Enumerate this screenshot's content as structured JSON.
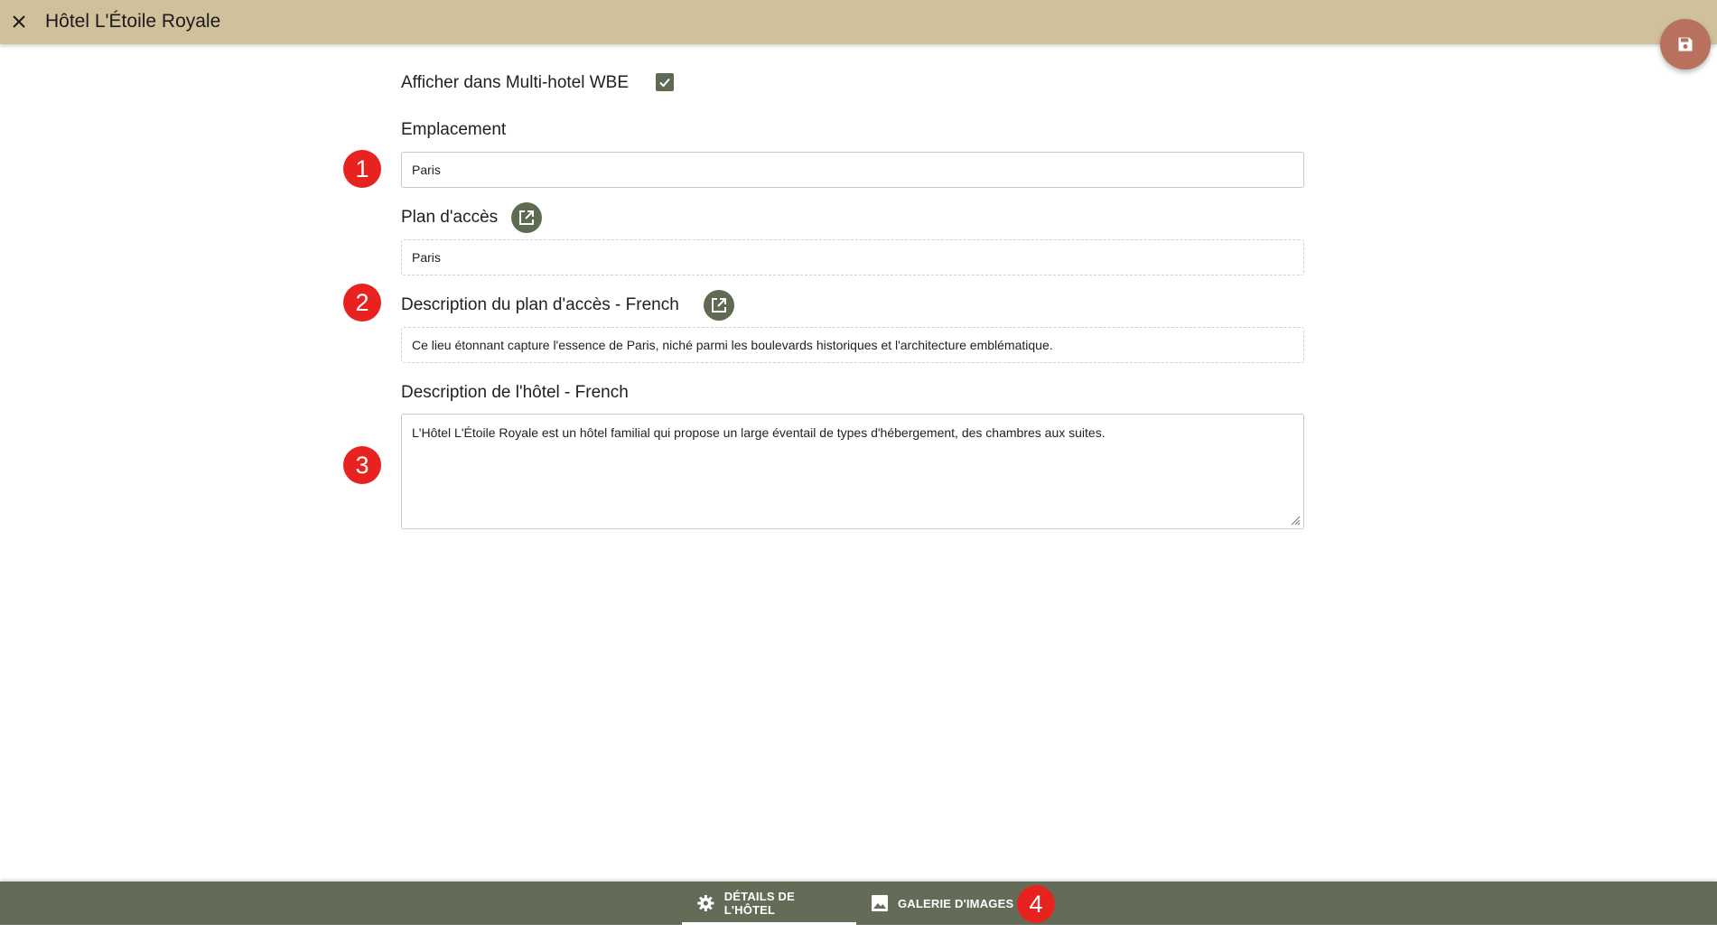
{
  "header": {
    "title": "Hôtel L'Étoile Royale",
    "close_icon": "close-icon",
    "save_icon": "save-icon"
  },
  "form": {
    "multi_hotel_label": "Afficher dans Multi-hotel WBE",
    "multi_hotel_checked": true,
    "location": {
      "label": "Emplacement",
      "value": "Paris"
    },
    "access_plan": {
      "label": "Plan d'accès",
      "value": "Paris",
      "icon": "open-external-icon"
    },
    "access_plan_description": {
      "label": "Description du plan d'accès - French",
      "value": "Ce lieu étonnant capture l'essence de Paris, niché parmi les boulevards historiques et l'architecture emblématique.",
      "icon": "open-external-icon"
    },
    "hotel_description": {
      "label": "Description de l'hôtel - French",
      "value": "L'Hôtel L'Étoile Royale est un hôtel familial qui propose un large éventail de types d'hébergement, des chambres aux suites."
    }
  },
  "badges": [
    "1",
    "2",
    "3",
    "4"
  ],
  "bottom_nav": {
    "tabs": [
      {
        "label": "DÉTAILS DE L'HÔTEL",
        "icon": "gear-icon",
        "active": true
      },
      {
        "label": "GALERIE D'IMAGES",
        "icon": "image-icon",
        "active": false
      }
    ]
  },
  "colors": {
    "header_bg": "#d0c19c",
    "accent": "#5f6a52",
    "save_button": "#b7715d",
    "badge": "#e8231f",
    "bottom_bar": "#646b56"
  }
}
